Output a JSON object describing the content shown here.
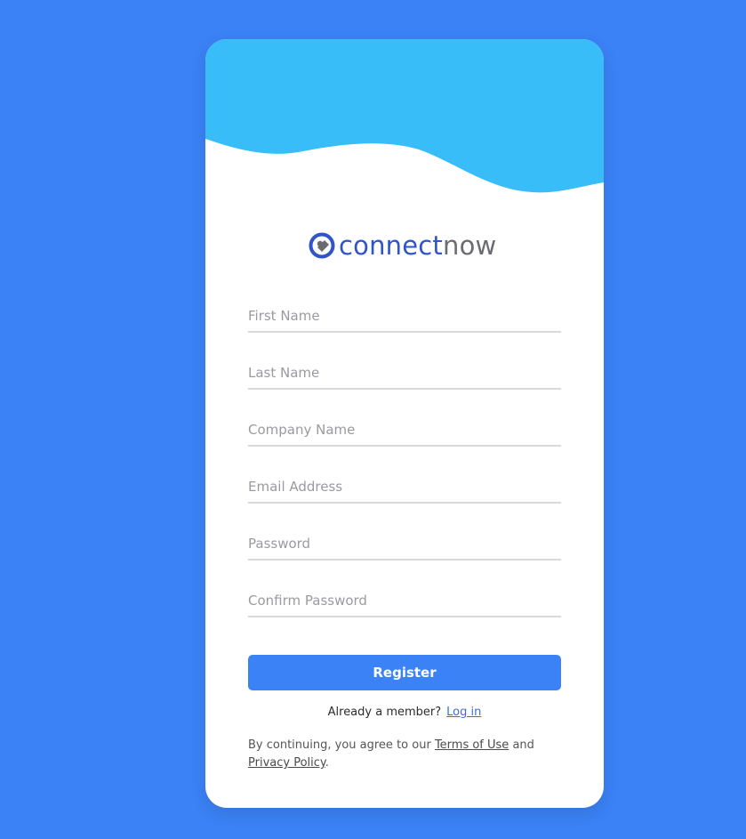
{
  "colors": {
    "background": "#3b82f6",
    "card": "#ffffff",
    "wave": "#38bdf8",
    "button": "#3b82f6",
    "logo_primary": "#2f55c8",
    "logo_secondary": "#6b6b72"
  },
  "logo": {
    "icon": "connectnow-logo-icon",
    "text_part1": "connect",
    "text_part2": "now"
  },
  "form": {
    "first_name": {
      "placeholder": "First Name",
      "value": ""
    },
    "last_name": {
      "placeholder": "Last Name",
      "value": ""
    },
    "company_name": {
      "placeholder": "Company Name",
      "value": ""
    },
    "email": {
      "placeholder": "Email Address",
      "value": ""
    },
    "password": {
      "placeholder": "Password",
      "value": ""
    },
    "confirm_password": {
      "placeholder": "Confirm Password",
      "value": ""
    }
  },
  "register_label": "Register",
  "member": {
    "text": "Already a member?",
    "link": "Log in"
  },
  "legal": {
    "prefix": "By continuing, you agree to our",
    "terms": "Terms of Use",
    "and": "and",
    "privacy": "Privacy Policy",
    "suffix": "."
  }
}
